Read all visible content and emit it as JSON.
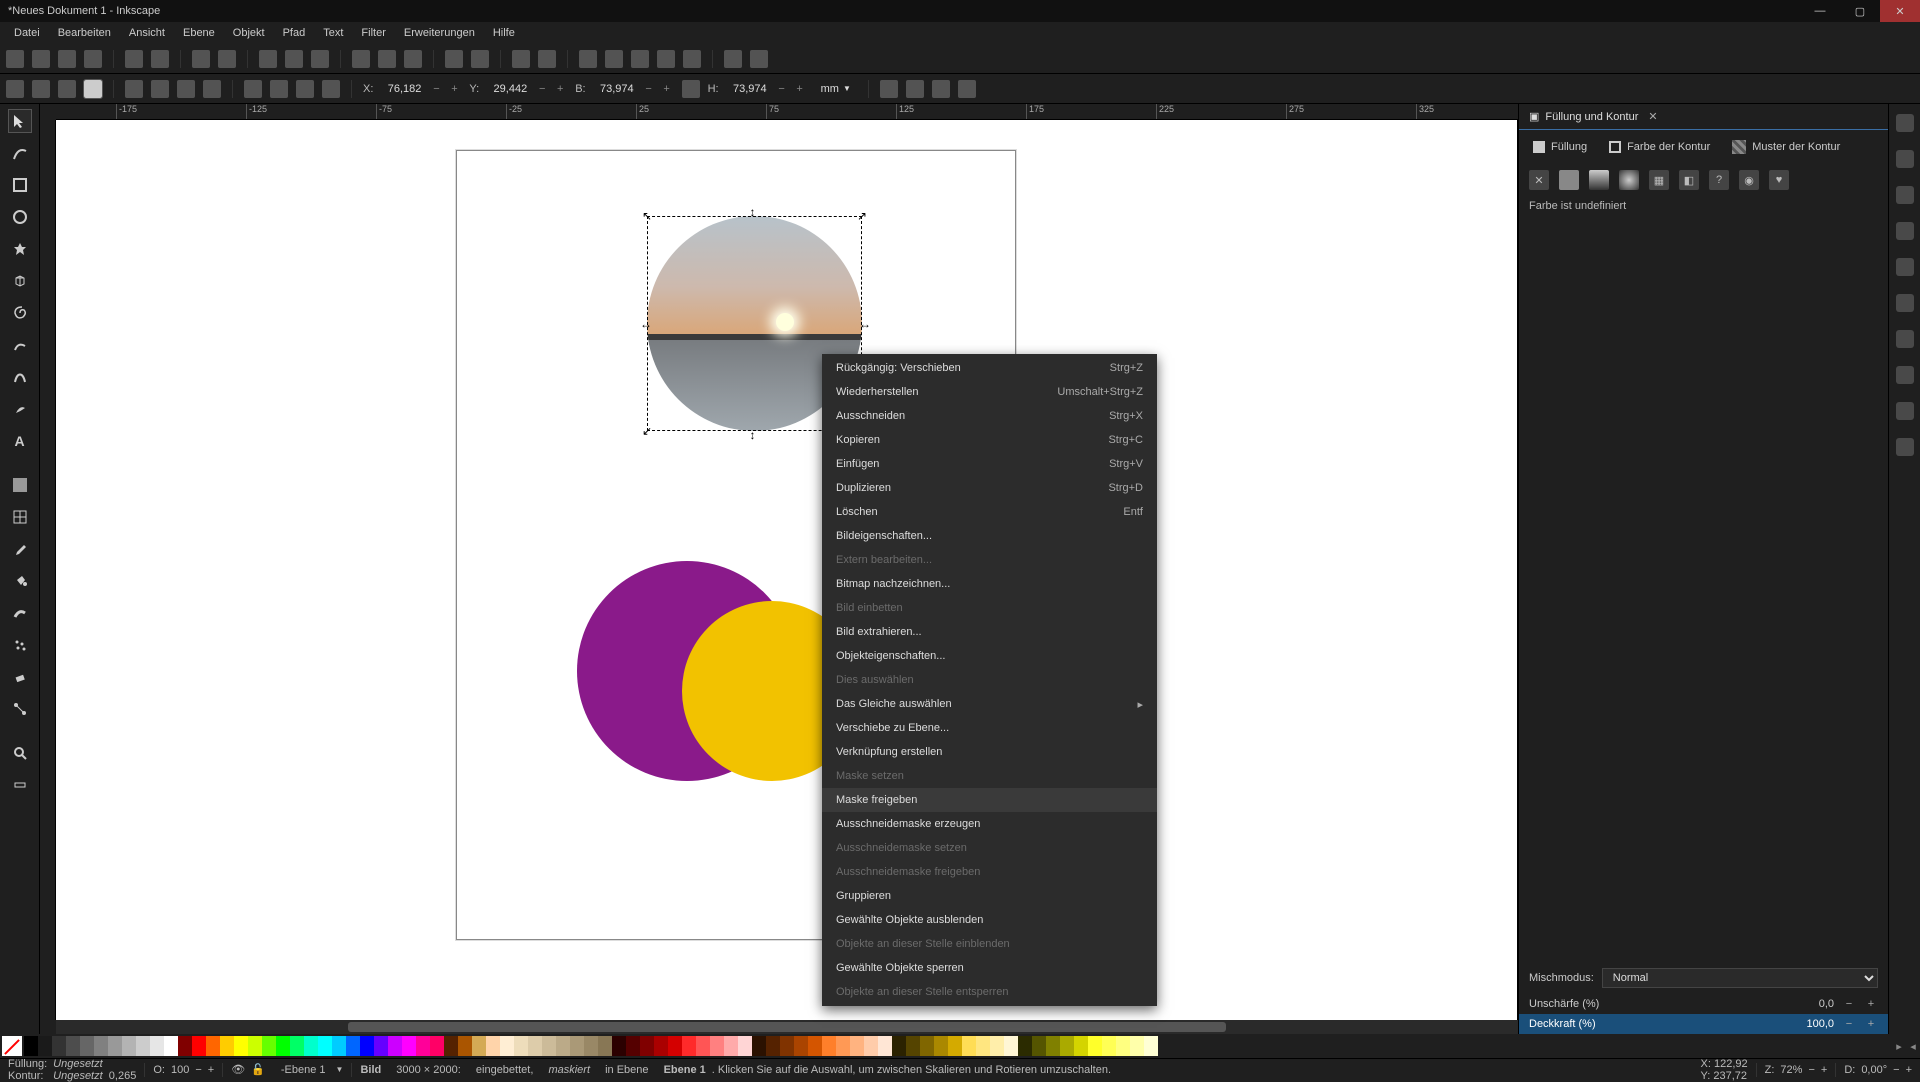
{
  "title": "*Neues Dokument 1 - Inkscape",
  "menu": [
    "Datei",
    "Bearbeiten",
    "Ansicht",
    "Ebene",
    "Objekt",
    "Pfad",
    "Text",
    "Filter",
    "Erweiterungen",
    "Hilfe"
  ],
  "coords": {
    "x_label": "X:",
    "x_value": "76,182",
    "y_label": "Y:",
    "y_value": "29,442",
    "w_label": "B:",
    "w_value": "73,974",
    "h_label": "H:",
    "h_value": "73,974",
    "unit": "mm"
  },
  "ruler_ticks": [
    "-175",
    "-125",
    "-75",
    "-25",
    "25",
    "75",
    "125",
    "175",
    "225",
    "275",
    "325"
  ],
  "panel": {
    "title": "Füllung und Kontur",
    "tabs": {
      "fill": "Füllung",
      "stroke": "Farbe der Kontur",
      "pattern": "Muster der Kontur"
    },
    "paint_msg": "Farbe ist undefiniert",
    "blend_label": "Mischmodus:",
    "blend_value": "Normal",
    "blur_label": "Unschärfe (%)",
    "blur_value": "0,0",
    "opacity_label": "Deckkraft (%)",
    "opacity_value": "100,0"
  },
  "context_menu": [
    {
      "label": "Rückgängig: Verschieben",
      "shortcut": "Strg+Z",
      "enabled": true
    },
    {
      "label": "Wiederherstellen",
      "shortcut": "Umschalt+Strg+Z",
      "enabled": true
    },
    {
      "label": "Ausschneiden",
      "shortcut": "Strg+X",
      "enabled": true
    },
    {
      "label": "Kopieren",
      "shortcut": "Strg+C",
      "enabled": true
    },
    {
      "label": "Einfügen",
      "shortcut": "Strg+V",
      "enabled": true
    },
    {
      "label": "Duplizieren",
      "shortcut": "Strg+D",
      "enabled": true
    },
    {
      "label": "Löschen",
      "shortcut": "Entf",
      "enabled": true
    },
    {
      "label": "Bildeigenschaften...",
      "shortcut": "",
      "enabled": true
    },
    {
      "label": "Extern bearbeiten...",
      "shortcut": "",
      "enabled": false
    },
    {
      "label": "Bitmap nachzeichnen...",
      "shortcut": "",
      "enabled": true
    },
    {
      "label": "Bild einbetten",
      "shortcut": "",
      "enabled": false
    },
    {
      "label": "Bild extrahieren...",
      "shortcut": "",
      "enabled": true
    },
    {
      "label": "Objekteigenschaften...",
      "shortcut": "",
      "enabled": true
    },
    {
      "label": "Dies auswählen",
      "shortcut": "",
      "enabled": false
    },
    {
      "label": "Das Gleiche auswählen",
      "shortcut": "",
      "enabled": true,
      "submenu": true
    },
    {
      "label": "Verschiebe zu Ebene...",
      "shortcut": "",
      "enabled": true
    },
    {
      "label": "Verknüpfung erstellen",
      "shortcut": "",
      "enabled": true
    },
    {
      "label": "Maske setzen",
      "shortcut": "",
      "enabled": false
    },
    {
      "label": "Maske freigeben",
      "shortcut": "",
      "enabled": true,
      "hover": true
    },
    {
      "label": "Ausschneidemaske erzeugen",
      "shortcut": "",
      "enabled": true
    },
    {
      "label": "Ausschneidemaske setzen",
      "shortcut": "",
      "enabled": false
    },
    {
      "label": "Ausschneidemaske freigeben",
      "shortcut": "",
      "enabled": false
    },
    {
      "label": "Gruppieren",
      "shortcut": "",
      "enabled": true
    },
    {
      "label": "Gewählte Objekte ausblenden",
      "shortcut": "",
      "enabled": true
    },
    {
      "label": "Objekte an dieser Stelle einblenden",
      "shortcut": "",
      "enabled": false
    },
    {
      "label": "Gewählte Objekte sperren",
      "shortcut": "",
      "enabled": true
    },
    {
      "label": "Objekte an dieser Stelle entsperren",
      "shortcut": "",
      "enabled": false
    }
  ],
  "status": {
    "fill_label": "Füllung:",
    "fill_value": "Ungesetzt",
    "stroke_label": "Kontur:",
    "stroke_value": "Ungesetzt",
    "stroke_w": "0,265",
    "o_label": "O:",
    "o_value": "100",
    "layer_prefix": "-Ebene 1",
    "desc_pre": "Bild",
    "desc_dim": "3000 × 2000:",
    "desc_emb": "eingebettet,",
    "desc_mask": "maskiert",
    "desc_in": "in Ebene",
    "desc_layer": "Ebene 1",
    "desc_tail": ". Klicken Sie auf die Auswahl, um zwischen Skalieren und Rotieren umzuschalten.",
    "cursor_x_label": "X:",
    "cursor_x": "122,92",
    "cursor_y_label": "Y:",
    "cursor_y": "237,72",
    "zoom_label": "Z:",
    "zoom": "72%",
    "rot_label": "D:",
    "rot": "0,00°"
  },
  "palette_colors": [
    "#000000",
    "#1a1a1a",
    "#333333",
    "#4d4d4d",
    "#666666",
    "#808080",
    "#999999",
    "#b3b3b3",
    "#cccccc",
    "#e6e6e6",
    "#ffffff",
    "#800000",
    "#ff0000",
    "#ff6600",
    "#ffcc00",
    "#ffff00",
    "#ccff00",
    "#66ff00",
    "#00ff00",
    "#00ff66",
    "#00ffcc",
    "#00ffff",
    "#00ccff",
    "#0066ff",
    "#0000ff",
    "#6600ff",
    "#cc00ff",
    "#ff00ff",
    "#ff0099",
    "#ff0066",
    "#552200",
    "#aa5500",
    "#d4aa55",
    "#ffd4aa",
    "#ffeed4",
    "#eeddbb",
    "#ddccaa",
    "#ccbb99",
    "#bbaa88",
    "#aa9977",
    "#998866",
    "#887755",
    "#2b0000",
    "#550000",
    "#800000",
    "#aa0000",
    "#d40000",
    "#ff2a2a",
    "#ff5555",
    "#ff8080",
    "#ffaaaa",
    "#ffd5d5",
    "#2b1100",
    "#552200",
    "#803300",
    "#aa4400",
    "#d45500",
    "#ff7f2a",
    "#ff9955",
    "#ffb380",
    "#ffccaa",
    "#ffe6d5",
    "#2b2200",
    "#554400",
    "#806600",
    "#aa8800",
    "#d4aa00",
    "#ffdd55",
    "#ffe680",
    "#ffeeaa",
    "#fff6d5",
    "#2b2b00",
    "#555500",
    "#808000",
    "#aaaa00",
    "#d4d400",
    "#ffff2a",
    "#ffff55",
    "#ffff80",
    "#ffffaa",
    "#ffffd5"
  ]
}
